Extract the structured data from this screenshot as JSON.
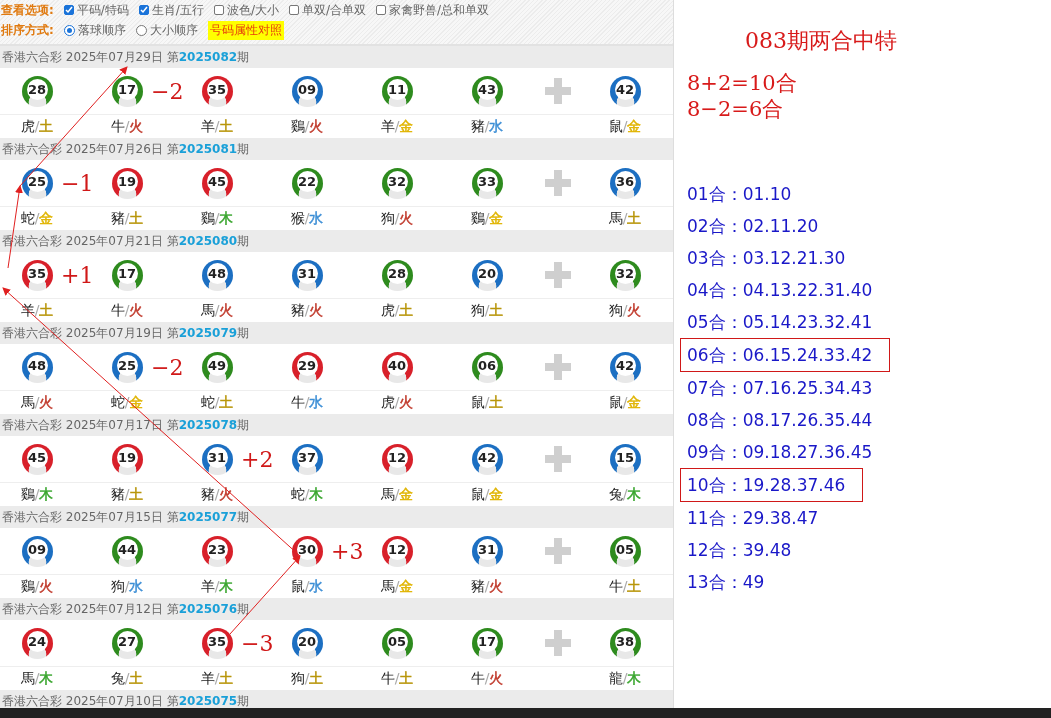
{
  "options": {
    "label": "查看选项:",
    "checkboxes": [
      {
        "label": "平码/特码",
        "checked": true
      },
      {
        "label": "生肖/五行",
        "checked": true
      },
      {
        "label": "波色/大小",
        "checked": false
      },
      {
        "label": "单双/合单双",
        "checked": false
      },
      {
        "label": "家禽野兽/总和单双",
        "checked": false
      }
    ]
  },
  "sort": {
    "label": "排序方式:",
    "radios": [
      {
        "label": "落球顺序",
        "selected": true
      },
      {
        "label": "大小顺序",
        "selected": false
      }
    ],
    "button": "号码属性对照"
  },
  "draws": [
    {
      "header": "香港六合彩 2025年07月29日 第**2025082**期",
      "balls": [
        {
          "number": "28",
          "color": "#2e8b1e",
          "zodiac": "虎",
          "separator": "/",
          "element": {
            "text": "土",
            "color": "#b8960c"
          }
        },
        {
          "number": "17",
          "color": "#2e8b1e",
          "zodiac": "牛",
          "separator": "/",
          "element": {
            "text": "火",
            "color": "#c0392b"
          },
          "note": "−2"
        },
        {
          "number": "35",
          "color": "#d8202a",
          "zodiac": "羊",
          "separator": "/",
          "element": {
            "text": "土",
            "color": "#b8960c"
          }
        },
        {
          "number": "09",
          "color": "#1c6fc2",
          "zodiac": "鷄",
          "separator": "/",
          "element": {
            "text": "火",
            "color": "#c0392b"
          }
        },
        {
          "number": "11",
          "color": "#2e8b1e",
          "zodiac": "羊",
          "separator": "/",
          "element": {
            "text": "金",
            "color": "#e0b400"
          }
        },
        {
          "number": "43",
          "color": "#2e8b1e",
          "zodiac": "豬",
          "separator": "/",
          "element": {
            "text": "水",
            "color": "#3d8fd6"
          }
        }
      ],
      "special": {
        "number": "42",
        "color": "#1c6fc2",
        "zodiac": "鼠",
        "separator": "/",
        "element": {
          "text": "金",
          "color": "#e0b400"
        }
      }
    },
    {
      "header": "香港六合彩 2025年07月26日 第**2025081**期",
      "balls": [
        {
          "number": "25",
          "color": "#1c6fc2",
          "zodiac": "蛇",
          "separator": "/",
          "element": {
            "text": "金",
            "color": "#e0b400"
          },
          "note": "−1"
        },
        {
          "number": "19",
          "color": "#d8202a",
          "zodiac": "豬",
          "separator": "/",
          "element": {
            "text": "土",
            "color": "#b8960c"
          }
        },
        {
          "number": "45",
          "color": "#d8202a",
          "zodiac": "鷄",
          "separator": "/",
          "element": {
            "text": "木",
            "color": "#3aa62f"
          }
        },
        {
          "number": "22",
          "color": "#2e8b1e",
          "zodiac": "猴",
          "separator": "/",
          "element": {
            "text": "水",
            "color": "#3d8fd6"
          }
        },
        {
          "number": "32",
          "color": "#2e8b1e",
          "zodiac": "狗",
          "separator": "/",
          "element": {
            "text": "火",
            "color": "#c0392b"
          }
        },
        {
          "number": "33",
          "color": "#2e8b1e",
          "zodiac": "鷄",
          "separator": "/",
          "element": {
            "text": "金",
            "color": "#e0b400"
          }
        }
      ],
      "special": {
        "number": "36",
        "color": "#1c6fc2",
        "zodiac": "馬",
        "separator": "/",
        "element": {
          "text": "土",
          "color": "#b8960c"
        }
      }
    },
    {
      "header": "香港六合彩 2025年07月21日 第**2025080**期",
      "balls": [
        {
          "number": "35",
          "color": "#d8202a",
          "zodiac": "羊",
          "separator": "/",
          "element": {
            "text": "土",
            "color": "#b8960c"
          },
          "note": "+1"
        },
        {
          "number": "17",
          "color": "#2e8b1e",
          "zodiac": "牛",
          "separator": "/",
          "element": {
            "text": "火",
            "color": "#c0392b"
          }
        },
        {
          "number": "48",
          "color": "#1c6fc2",
          "zodiac": "馬",
          "separator": "/",
          "element": {
            "text": "火",
            "color": "#c0392b"
          }
        },
        {
          "number": "31",
          "color": "#1c6fc2",
          "zodiac": "豬",
          "separator": "/",
          "element": {
            "text": "火",
            "color": "#c0392b"
          }
        },
        {
          "number": "28",
          "color": "#2e8b1e",
          "zodiac": "虎",
          "separator": "/",
          "element": {
            "text": "土",
            "color": "#b8960c"
          }
        },
        {
          "number": "20",
          "color": "#1c6fc2",
          "zodiac": "狗",
          "separator": "/",
          "element": {
            "text": "土",
            "color": "#b8960c"
          }
        }
      ],
      "special": {
        "number": "32",
        "color": "#2e8b1e",
        "zodiac": "狗",
        "separator": "/",
        "element": {
          "text": "火",
          "color": "#c0392b"
        }
      }
    },
    {
      "header": "香港六合彩 2025年07月19日 第**2025079**期",
      "balls": [
        {
          "number": "48",
          "color": "#1c6fc2",
          "zodiac": "馬",
          "separator": "/",
          "element": {
            "text": "火",
            "color": "#c0392b"
          }
        },
        {
          "number": "25",
          "color": "#1c6fc2",
          "zodiac": "蛇",
          "separator": "/",
          "element": {
            "text": "金",
            "color": "#e0b400"
          },
          "note": "−2"
        },
        {
          "number": "49",
          "color": "#2e8b1e",
          "zodiac": "蛇",
          "separator": "/",
          "element": {
            "text": "土",
            "color": "#b8960c"
          }
        },
        {
          "number": "29",
          "color": "#d8202a",
          "zodiac": "牛",
          "separator": "/",
          "element": {
            "text": "水",
            "color": "#3d8fd6"
          }
        },
        {
          "number": "40",
          "color": "#d8202a",
          "zodiac": "虎",
          "separator": "/",
          "element": {
            "text": "火",
            "color": "#c0392b"
          }
        },
        {
          "number": "06",
          "color": "#2e8b1e",
          "zodiac": "鼠",
          "separator": "/",
          "element": {
            "text": "土",
            "color": "#b8960c"
          }
        }
      ],
      "special": {
        "number": "42",
        "color": "#1c6fc2",
        "zodiac": "鼠",
        "separator": "/",
        "element": {
          "text": "金",
          "color": "#e0b400"
        }
      }
    },
    {
      "header": "香港六合彩 2025年07月17日 第**2025078**期",
      "balls": [
        {
          "number": "45",
          "color": "#d8202a",
          "zodiac": "鷄",
          "separator": "/",
          "element": {
            "text": "木",
            "color": "#3aa62f"
          }
        },
        {
          "number": "19",
          "color": "#d8202a",
          "zodiac": "豬",
          "separator": "/",
          "element": {
            "text": "土",
            "color": "#b8960c"
          }
        },
        {
          "number": "31",
          "color": "#1c6fc2",
          "zodiac": "豬",
          "separator": "/",
          "element": {
            "text": "火",
            "color": "#c0392b"
          },
          "note": "+2"
        },
        {
          "number": "37",
          "color": "#1c6fc2",
          "zodiac": "蛇",
          "separator": "/",
          "element": {
            "text": "木",
            "color": "#3aa62f"
          }
        },
        {
          "number": "12",
          "color": "#d8202a",
          "zodiac": "馬",
          "separator": "/",
          "element": {
            "text": "金",
            "color": "#e0b400"
          }
        },
        {
          "number": "42",
          "color": "#1c6fc2",
          "zodiac": "鼠",
          "separator": "/",
          "element": {
            "text": "金",
            "color": "#e0b400"
          }
        }
      ],
      "special": {
        "number": "15",
        "color": "#1c6fc2",
        "zodiac": "兔",
        "separator": "/",
        "element": {
          "text": "木",
          "color": "#3aa62f"
        }
      }
    },
    {
      "header": "香港六合彩 2025年07月15日 第**2025077**期",
      "balls": [
        {
          "number": "09",
          "color": "#1c6fc2",
          "zodiac": "鷄",
          "separator": "/",
          "element": {
            "text": "火",
            "color": "#c0392b"
          }
        },
        {
          "number": "44",
          "color": "#2e8b1e",
          "zodiac": "狗",
          "separator": "/",
          "element": {
            "text": "水",
            "color": "#3d8fd6"
          }
        },
        {
          "number": "23",
          "color": "#d8202a",
          "zodiac": "羊",
          "separator": "/",
          "element": {
            "text": "木",
            "color": "#3aa62f"
          }
        },
        {
          "number": "30",
          "color": "#d8202a",
          "zodiac": "鼠",
          "separator": "/",
          "element": {
            "text": "水",
            "color": "#3d8fd6"
          },
          "note": "+3"
        },
        {
          "number": "12",
          "color": "#d8202a",
          "zodiac": "馬",
          "separator": "/",
          "element": {
            "text": "金",
            "color": "#e0b400"
          }
        },
        {
          "number": "31",
          "color": "#1c6fc2",
          "zodiac": "豬",
          "separator": "/",
          "element": {
            "text": "火",
            "color": "#c0392b"
          }
        }
      ],
      "special": {
        "number": "05",
        "color": "#2e8b1e",
        "zodiac": "牛",
        "separator": "/",
        "element": {
          "text": "土",
          "color": "#b8960c"
        }
      }
    },
    {
      "header": "香港六合彩 2025年07月12日 第**2025076**期",
      "balls": [
        {
          "number": "24",
          "color": "#d8202a",
          "zodiac": "馬",
          "separator": "/",
          "element": {
            "text": "木",
            "color": "#3aa62f"
          }
        },
        {
          "number": "27",
          "color": "#2e8b1e",
          "zodiac": "兔",
          "separator": "/",
          "element": {
            "text": "土",
            "color": "#b8960c"
          }
        },
        {
          "number": "35",
          "color": "#d8202a",
          "zodiac": "羊",
          "separator": "/",
          "element": {
            "text": "土",
            "color": "#b8960c"
          },
          "note": "−3"
        },
        {
          "number": "20",
          "color": "#1c6fc2",
          "zodiac": "狗",
          "separator": "/",
          "element": {
            "text": "土",
            "color": "#b8960c"
          }
        },
        {
          "number": "05",
          "color": "#2e8b1e",
          "zodiac": "牛",
          "separator": "/",
          "element": {
            "text": "土",
            "color": "#b8960c"
          }
        },
        {
          "number": "17",
          "color": "#2e8b1e",
          "zodiac": "牛",
          "separator": "/",
          "element": {
            "text": "火",
            "color": "#c0392b"
          }
        }
      ],
      "special": {
        "number": "38",
        "color": "#2e8b1e",
        "zodiac": "龍",
        "separator": "/",
        "element": {
          "text": "木",
          "color": "#3aa62f"
        }
      }
    }
  ],
  "cut_header": "香港六合彩 2025年07月10日 第**2025075**期",
  "notes": {
    "title": "083期两合中特",
    "formulas": [
      "8+2=10合",
      "8−2=6合"
    ],
    "combos": [
      {
        "text": "01合：01.10",
        "boxed": false
      },
      {
        "text": "02合：02.11.20",
        "boxed": false
      },
      {
        "text": "03合：03.12.21.30",
        "boxed": false
      },
      {
        "text": "04合：04.13.22.31.40",
        "boxed": false
      },
      {
        "text": "05合：05.14.23.32.41",
        "boxed": false
      },
      {
        "text": "06合：06.15.24.33.42",
        "boxed": true
      },
      {
        "text": "07合：07.16.25.34.43",
        "boxed": false
      },
      {
        "text": "08合：08.17.26.35.44",
        "boxed": false
      },
      {
        "text": "09合：09.18.27.36.45",
        "boxed": false
      },
      {
        "text": "10合：19.28.37.46",
        "boxed": true
      },
      {
        "text": "11合：29.38.47",
        "boxed": false
      },
      {
        "text": "12合：39.48",
        "boxed": false
      },
      {
        "text": "13合：49",
        "boxed": false
      }
    ]
  }
}
